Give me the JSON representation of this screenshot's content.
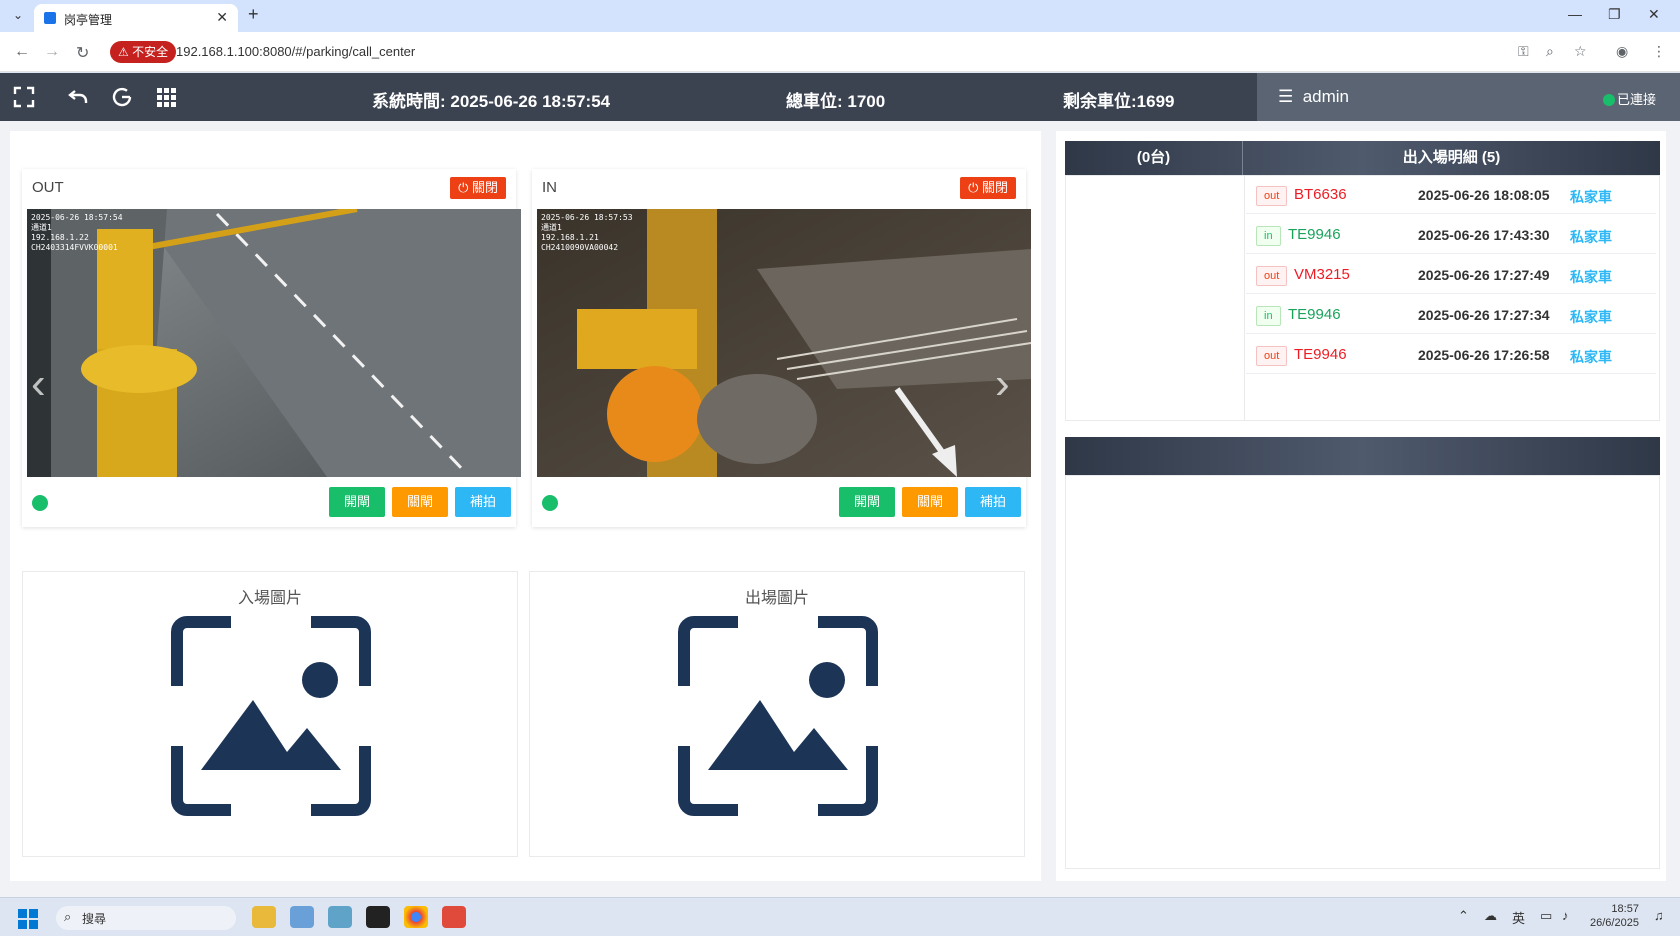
{
  "browser": {
    "tab_title": "岗亭管理",
    "security_label": "不安全",
    "url": "192.168.1.100:8080/#/parking/call_center"
  },
  "topbar": {
    "system_time_label": "系統時間: 2025-06-26 18:57:54",
    "total_spaces_label": "總車位: 1700",
    "remaining_spaces_label": "剩余車位:1699",
    "user": "admin",
    "connection_status": "已連接"
  },
  "cameras": [
    {
      "title": "OUT",
      "close_label": "關閉",
      "overlay": [
        "2025-06-26 18:57:54",
        "通道1",
        "192.168.1.22",
        "CH2403314FVVK00001"
      ],
      "buttons": {
        "open": "開閘",
        "close": "關閘",
        "snap": "補拍"
      }
    },
    {
      "title": "IN",
      "close_label": "關閉",
      "overlay": [
        "2025-06-26 18:57:53",
        "通道1",
        "192.168.1.21",
        "CH2410090VA00042"
      ],
      "buttons": {
        "open": "開閘",
        "close": "關閘",
        "snap": "補拍"
      }
    }
  ],
  "images": {
    "entry_title": "入場圖片",
    "exit_title": "出場圖片"
  },
  "records": {
    "count_header": "(0台)",
    "detail_header": "出入場明細 (5)",
    "rows": [
      {
        "dir": "out",
        "plate": "BT6636",
        "time": "2025-06-26 18:08:05",
        "type": "私家車"
      },
      {
        "dir": "in",
        "plate": "TE9946",
        "time": "2025-06-26 17:43:30",
        "type": "私家車"
      },
      {
        "dir": "out",
        "plate": "VM3215",
        "time": "2025-06-26 17:27:49",
        "type": "私家車"
      },
      {
        "dir": "in",
        "plate": "TE9946",
        "time": "2025-06-26 17:27:34",
        "type": "私家車"
      },
      {
        "dir": "out",
        "plate": "TE9946",
        "time": "2025-06-26 17:26:58",
        "type": "私家車"
      }
    ]
  },
  "taskbar": {
    "search_placeholder": "搜尋",
    "lang": "英",
    "clock_time": "18:57",
    "clock_date": "26/6/2025"
  },
  "colors": {
    "danger": "#ed4014",
    "success": "#19be6b",
    "warning": "#ff9900",
    "info": "#2db7f5",
    "appbar": "#3b4250"
  }
}
